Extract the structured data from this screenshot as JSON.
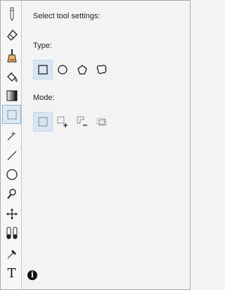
{
  "settings": {
    "heading": "Select tool settings:",
    "type_label": "Type:",
    "mode_label": "Mode:"
  },
  "toolbar": {
    "active_tool": "rectangle-select",
    "tools": [
      "pencil",
      "eraser",
      "brush",
      "fill",
      "gradient",
      "rectangle-select",
      "magic-wand",
      "line",
      "ellipse",
      "zoom",
      "move",
      "color-swap",
      "eyedropper",
      "text"
    ]
  },
  "types": [
    "rectangle",
    "ellipse",
    "polygon",
    "freeform"
  ],
  "selected_type": "rectangle",
  "modes": [
    "replace",
    "add",
    "subtract",
    "intersect"
  ],
  "selected_mode": "replace",
  "text_tool_glyph": "T",
  "info_glyph": "i",
  "colors": {
    "active_tool_bg": "#dbe8f5",
    "selected_option_bg": "#d8e5f3",
    "accent_orange": "#f2a04b"
  }
}
